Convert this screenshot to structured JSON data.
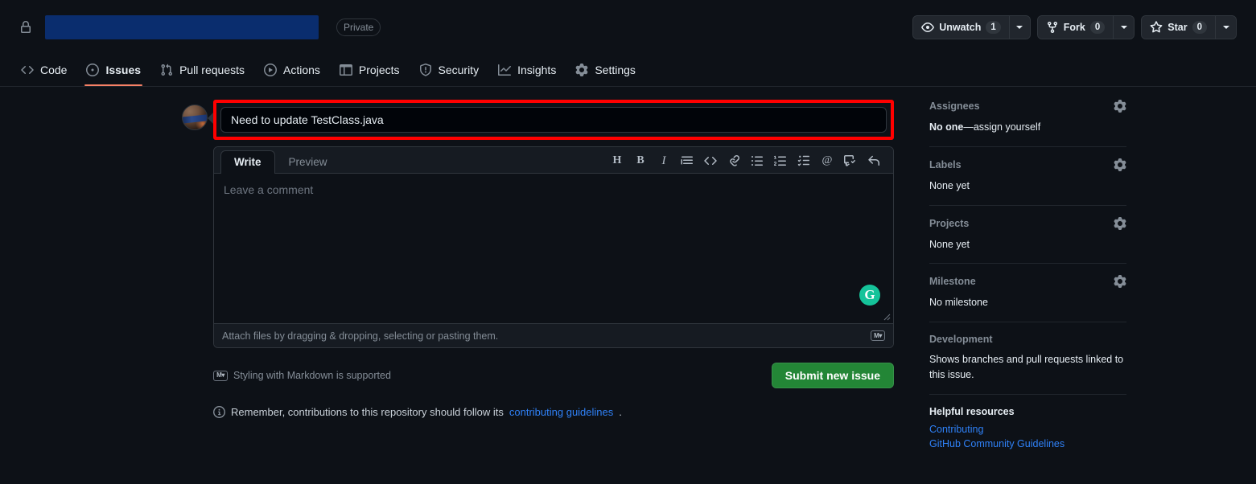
{
  "repo_header": {
    "lock_icon": "lock-icon",
    "repo_name": "",
    "visibility": "Private",
    "actions": [
      {
        "icon": "eye-icon",
        "label": "Unwatch",
        "count": "1"
      },
      {
        "icon": "fork-icon",
        "label": "Fork",
        "count": "0"
      },
      {
        "icon": "star-icon",
        "label": "Star",
        "count": "0"
      }
    ]
  },
  "nav": {
    "items": [
      {
        "icon": "code-icon",
        "label": "Code",
        "selected": false
      },
      {
        "icon": "issue-opened-icon",
        "label": "Issues",
        "selected": true
      },
      {
        "icon": "git-pull-request-icon",
        "label": "Pull requests",
        "selected": false
      },
      {
        "icon": "play-icon",
        "label": "Actions",
        "selected": false
      },
      {
        "icon": "table-icon",
        "label": "Projects",
        "selected": false
      },
      {
        "icon": "shield-icon",
        "label": "Security",
        "selected": false
      },
      {
        "icon": "graph-icon",
        "label": "Insights",
        "selected": false
      },
      {
        "icon": "gear-icon",
        "label": "Settings",
        "selected": false
      }
    ]
  },
  "issue_form": {
    "title_value": "Need to update TestClass.java",
    "title_placeholder": "Title",
    "highlight_color": "#ff0000",
    "tabs": [
      {
        "label": "Write",
        "selected": true
      },
      {
        "label": "Preview",
        "selected": false
      }
    ],
    "toolbar": [
      {
        "icon": "heading-icon",
        "glyph": "H"
      },
      {
        "icon": "bold-icon",
        "glyph": "B"
      },
      {
        "icon": "italic-icon",
        "glyph": "I"
      },
      {
        "icon": "quote-icon",
        "glyph": ""
      },
      {
        "icon": "code-icon",
        "glyph": ""
      },
      {
        "icon": "link-icon",
        "glyph": ""
      },
      {
        "icon": "unordered-list-icon",
        "glyph": ""
      },
      {
        "icon": "ordered-list-icon",
        "glyph": ""
      },
      {
        "icon": "task-list-icon",
        "glyph": ""
      },
      {
        "icon": "mention-icon",
        "glyph": "@"
      },
      {
        "icon": "saved-reply-icon",
        "glyph": ""
      },
      {
        "icon": "reply-icon",
        "glyph": ""
      }
    ],
    "comment_value": "",
    "comment_placeholder": "Leave a comment",
    "grammarly_badge": "G",
    "dropzone_text": "Attach files by dragging & dropping, selecting or pasting them.",
    "markdown_icon_label": "M",
    "markdown_note": "Styling with Markdown is supported",
    "submit_label": "Submit new issue",
    "contributing_note_prefix": "Remember, contributions to this repository should follow its ",
    "contributing_link": "contributing guidelines",
    "contributing_note_suffix": "."
  },
  "sidebar": {
    "assignees": {
      "title": "Assignees",
      "value_strong": "No one",
      "value_rest": "—assign yourself"
    },
    "labels": {
      "title": "Labels",
      "value": "None yet"
    },
    "projects": {
      "title": "Projects",
      "value": "None yet"
    },
    "milestone": {
      "title": "Milestone",
      "value": "No milestone"
    },
    "development": {
      "title": "Development",
      "value": "Shows branches and pull requests linked to this issue."
    },
    "helpful": {
      "title": "Helpful resources",
      "links": [
        "Contributing",
        "GitHub Community Guidelines"
      ]
    }
  },
  "colors": {
    "page_bg": "#0d1117",
    "accent_green": "#238636",
    "link_blue": "#2f81f7",
    "tab_underline": "#f78166",
    "grammarly_green": "#15c39a",
    "redaction_blue": "#0a2d6e"
  }
}
